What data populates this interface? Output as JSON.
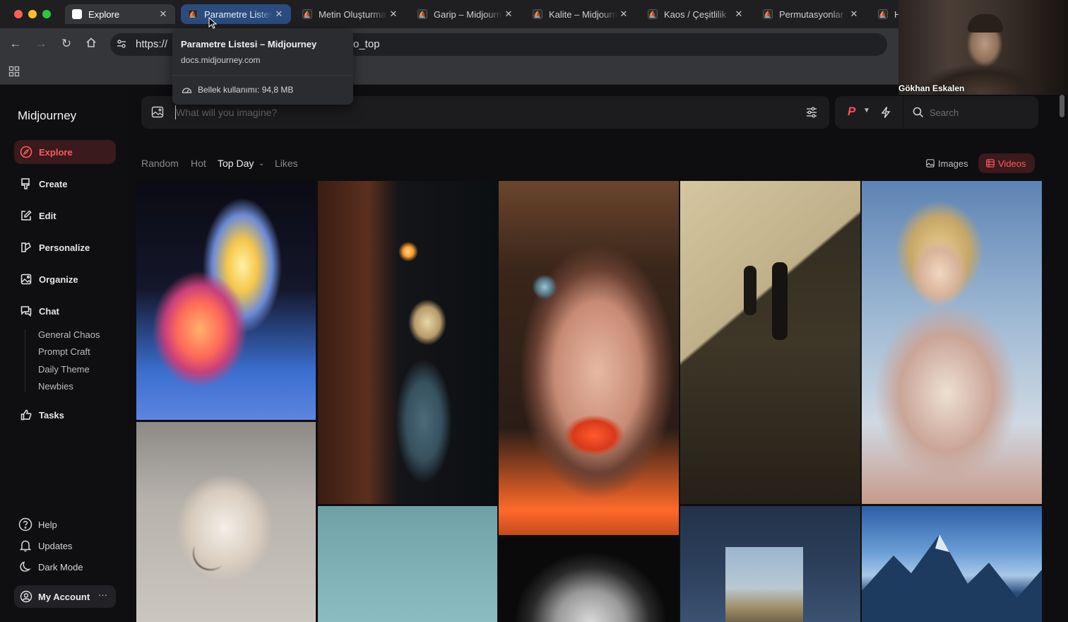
{
  "browser": {
    "tabs": [
      {
        "label": "Explore"
      },
      {
        "label": "Parametre Listesi – Midjourney"
      },
      {
        "label": "Metin Oluşturma"
      },
      {
        "label": "Garip – Midjourney"
      },
      {
        "label": "Kalite – Midjourney"
      },
      {
        "label": "Kaos / Çeşitlilik"
      },
      {
        "label": "Permutasyonlar"
      },
      {
        "label": "H"
      }
    ],
    "close_glyph": "✕",
    "url_left": "https://",
    "url_right": "o_top",
    "tooltip": {
      "title": "Parametre Listesi – Midjourney",
      "domain": "docs.midjourney.com",
      "memory": "Bellek kullanımı: 94,8 MB"
    }
  },
  "webcam": {
    "name": "Gökhan Eskalen"
  },
  "app": {
    "brand": "Midjourney",
    "accent_color": "#ff5a5f",
    "nav": [
      {
        "label": "Explore",
        "icon": "compass-icon",
        "active": true
      },
      {
        "label": "Create",
        "icon": "brush-icon"
      },
      {
        "label": "Edit",
        "icon": "edit-icon"
      },
      {
        "label": "Personalize",
        "icon": "personalize-icon"
      },
      {
        "label": "Organize",
        "icon": "image-icon"
      },
      {
        "label": "Chat",
        "icon": "chat-icon"
      }
    ],
    "chat_rooms": [
      "General Chaos",
      "Prompt Craft",
      "Daily Theme",
      "Newbies"
    ],
    "tasks_label": "Tasks",
    "bottom": {
      "help": "Help",
      "updates": "Updates",
      "dark_mode": "Dark Mode",
      "account": "My Account",
      "account_more": "···"
    },
    "prompt": {
      "placeholder": "What will you imagine?"
    },
    "search": {
      "placeholder": "Search"
    },
    "filters": {
      "random": "Random",
      "hot": "Hot",
      "top_day": "Top Day",
      "likes": "Likes",
      "images": "Images",
      "videos": "Videos"
    }
  }
}
